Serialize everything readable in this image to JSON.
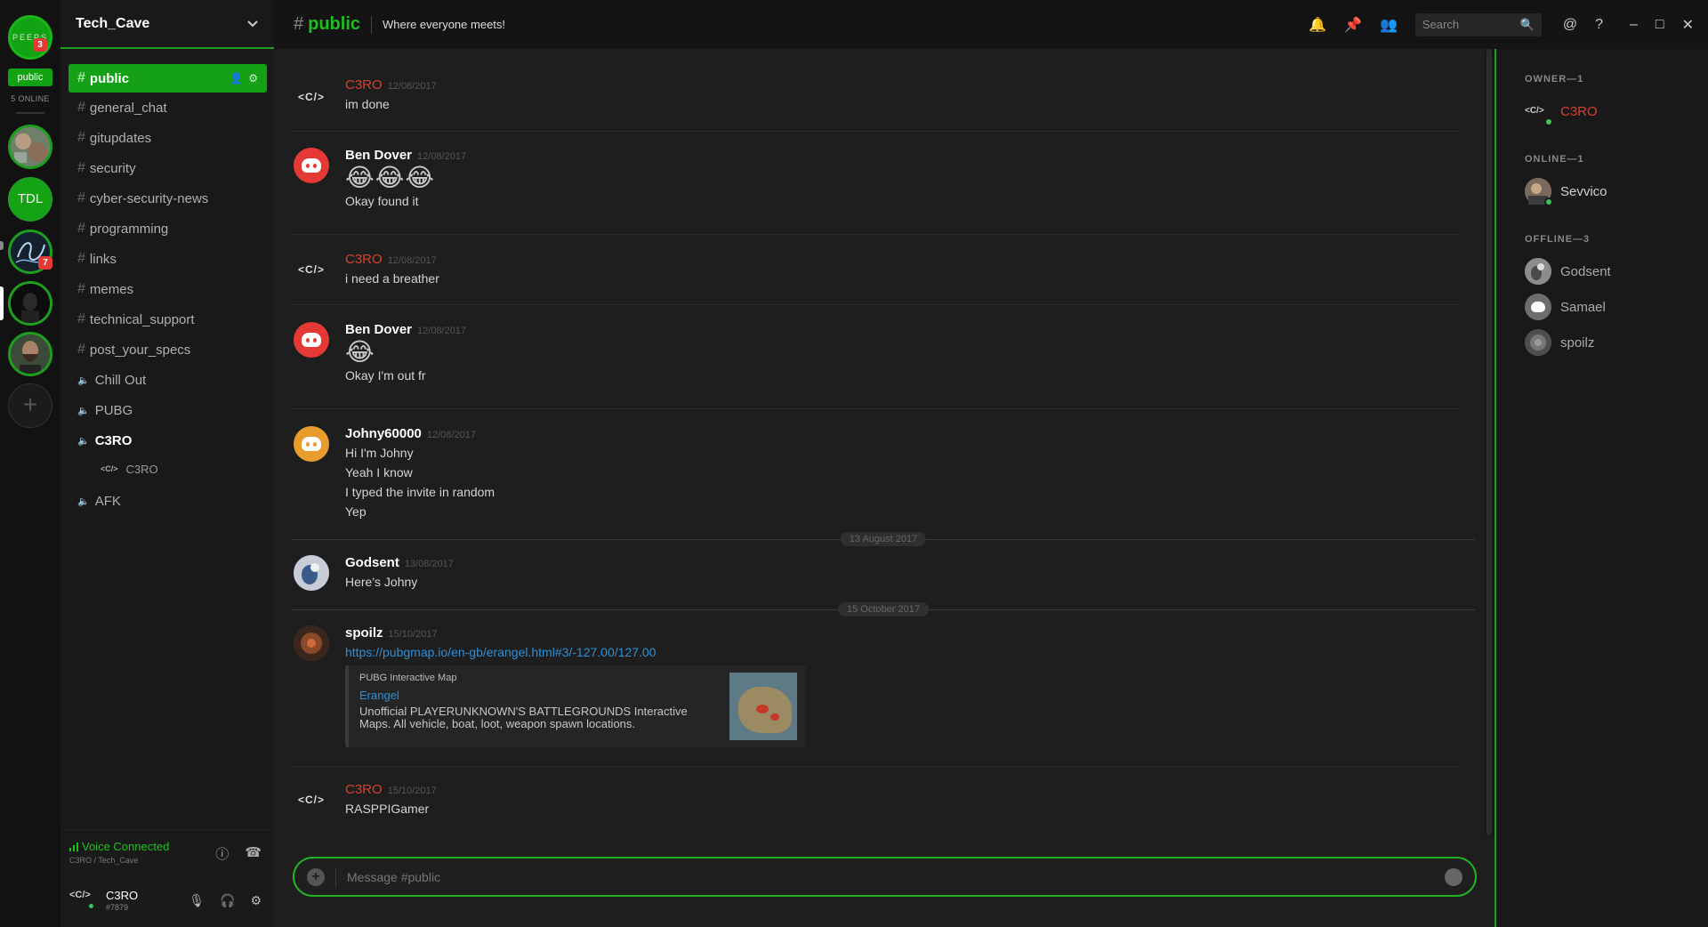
{
  "rail": {
    "peeps_label": "PEEPS",
    "peeps_badge": "3",
    "public_pill": "public",
    "online_label": "5 ONLINE",
    "tdl_label": "TDL",
    "dark_server_badge": "7"
  },
  "guild": {
    "name": "Tech_Cave"
  },
  "channels": [
    {
      "name": "public",
      "type": "text"
    },
    {
      "name": "general_chat",
      "type": "text"
    },
    {
      "name": "gitupdates",
      "type": "text"
    },
    {
      "name": "security",
      "type": "text"
    },
    {
      "name": "cyber-security-news",
      "type": "text"
    },
    {
      "name": "programming",
      "type": "text"
    },
    {
      "name": "links",
      "type": "text"
    },
    {
      "name": "memes",
      "type": "text"
    },
    {
      "name": "technical_support",
      "type": "text"
    },
    {
      "name": "post_your_specs",
      "type": "text"
    },
    {
      "name": "Chill Out",
      "type": "voice"
    },
    {
      "name": "PUBG",
      "type": "voice"
    },
    {
      "name": "C3RO",
      "type": "voice"
    },
    {
      "name": "AFK",
      "type": "voice"
    }
  ],
  "voice_channel_user": {
    "avatar": "<C/>",
    "name": "C3RO"
  },
  "voice_panel": {
    "status": "Voice Connected",
    "sub": "C3RO / Tech_Cave"
  },
  "user_panel": {
    "avatar": "<C/>",
    "name": "C3RO",
    "tag": "#7879"
  },
  "topbar": {
    "channel": "public",
    "topic": "Where everyone meets!",
    "search_placeholder": "Search"
  },
  "messages": [
    {
      "author": "C3RO",
      "time": "12/08/2017",
      "avatar": "<C/>",
      "lines": [
        "im done"
      ]
    },
    {
      "author": "Ben Dover",
      "time": "12/08/2017",
      "emoji": "😂😂😂",
      "lines": [
        "Okay found it"
      ]
    },
    {
      "author": "C3RO",
      "time": "12/08/2017",
      "avatar": "<C/>",
      "lines": [
        "i need a breather"
      ]
    },
    {
      "author": "Ben Dover",
      "time": "12/08/2017",
      "emoji": "😂",
      "lines": [
        "Okay I'm out fr"
      ]
    },
    {
      "author": "Johny60000",
      "time": "12/08/2017",
      "lines": [
        "Hi I'm Johny",
        "Yeah I know",
        "I typed the invite in random",
        "Yep"
      ]
    },
    {
      "author": "Godsent",
      "time": "13/08/2017",
      "lines": [
        "Here's Johny"
      ]
    },
    {
      "author": "spoilz",
      "time": "15/10/2017",
      "link": "https://pubgmap.io/en-gb/erangel.html#3/-127.00/127.00",
      "embed": {
        "provider": "PUBG Interactive Map",
        "title": "Erangel",
        "description": "Unofficial PLAYERUNKNOWN'S BATTLEGROUNDS Interactive Maps. All vehicle, boat, loot, weapon spawn locations."
      }
    },
    {
      "author": "C3RO",
      "time": "15/10/2017",
      "avatar": "<C/>",
      "lines": [
        "RASPPIGamer"
      ]
    }
  ],
  "date_dividers": [
    "13 August 2017",
    "15 October 2017"
  ],
  "composer": {
    "placeholder": "Message #public"
  },
  "members": {
    "owner_header": "OWNER—1",
    "online_header": "ONLINE—1",
    "offline_header": "OFFLINE—3",
    "owner": {
      "name": "C3RO",
      "avatar": "<C/>"
    },
    "online": [
      {
        "name": "Sevvico"
      }
    ],
    "offline": [
      {
        "name": "Godsent"
      },
      {
        "name": "Samael"
      },
      {
        "name": "spoilz"
      }
    ]
  },
  "colors": {
    "accent": "#15a115",
    "owner_name": "#d8402c",
    "link": "#2f8fd6",
    "background": "#1e1e1e"
  }
}
